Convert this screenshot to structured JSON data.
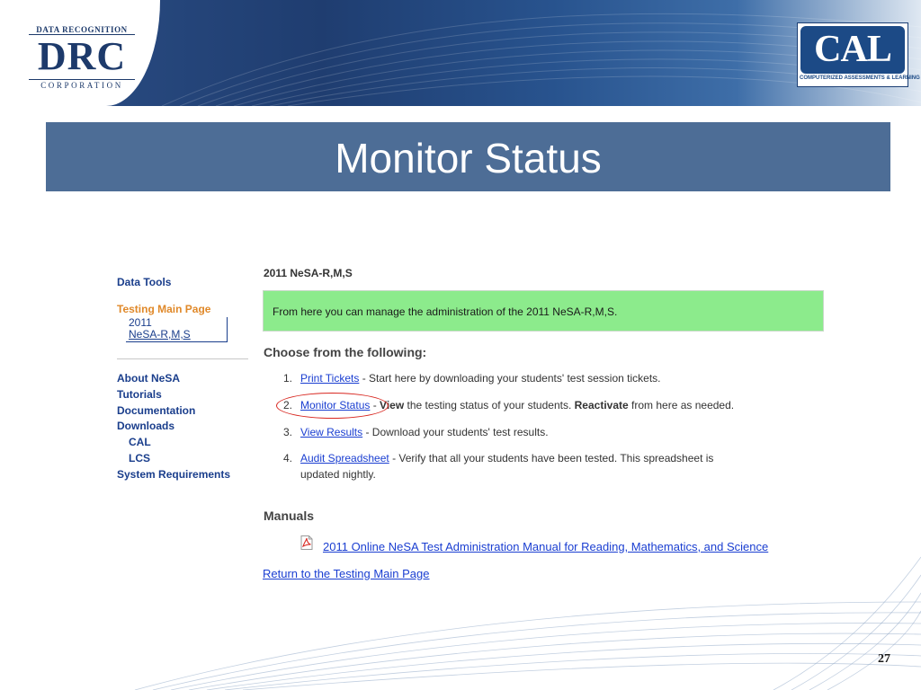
{
  "header": {
    "drc_logo": {
      "top_text": "DATA RECOGNITION",
      "main_text": "DRC",
      "bottom_text": "CORPORATION"
    },
    "cal_logo": {
      "letters": "CAL",
      "caption": "COMPUTERIZED ASSESSMENTS & LEARNING"
    }
  },
  "slide": {
    "title": "Monitor Status",
    "page_number": "27"
  },
  "sidebar": {
    "data_tools": "Data Tools",
    "testing_main": "Testing Main Page",
    "current_line1": "2011",
    "current_line2": "NeSA-R,M,S",
    "about": "About NeSA",
    "tutorials": "Tutorials",
    "documentation": "Documentation",
    "downloads": "Downloads",
    "cal": "CAL",
    "lcs": "LCS",
    "system_requirements": "System Requirements"
  },
  "main": {
    "heading": "2011 NeSA-R,M,S",
    "banner_text": "From here you can manage the administration of the 2011 NeSA-R,M,S.",
    "choose_heading": "Choose from the following:",
    "steps": [
      {
        "num": "1.",
        "link": "Print Tickets",
        "text": " - Start here by downloading your students' test session tickets."
      },
      {
        "num": "2.",
        "link": "Monitor Status",
        "pre": " - ",
        "bold1": "View",
        "mid": " the testing status of your students. ",
        "bold2": "Reactivate",
        "post": " from here as needed."
      },
      {
        "num": "3.",
        "link": "View Results",
        "text": " - Download your students' test results."
      },
      {
        "num": "4.",
        "link": "Audit Spreadsheet",
        "text": " - Verify that all your students have been tested. This spreadsheet is",
        "text2": "updated nightly."
      }
    ],
    "manuals_heading": "Manuals",
    "manual_link": "2011 Online NeSA Test Administration Manual for Reading, Mathematics, and Science",
    "return_link": "Return to the Testing Main Page"
  },
  "colors": {
    "header_blue": "#1f3d70",
    "banner_blue": "#4d6d96",
    "nav_blue": "#1a3e8c",
    "nav_current": "#e0892a",
    "link_blue": "#1a3ed1",
    "banner_green": "#8ceb8c",
    "highlight_red": "#d8261f"
  },
  "icons": [
    "pdf-icon"
  ]
}
